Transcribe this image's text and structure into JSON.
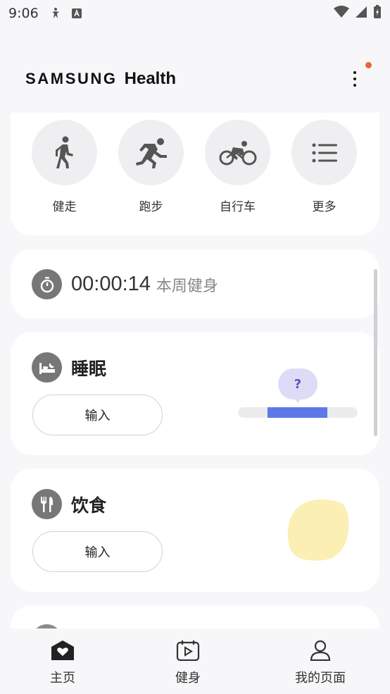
{
  "status_bar": {
    "time": "9:06",
    "icons": [
      "accessibility-icon",
      "keyboard-a-icon",
      "wifi-icon",
      "cellular-icon",
      "battery-icon"
    ]
  },
  "header": {
    "brand_samsung": "SAMSUNG",
    "brand_health": "Health",
    "more_menu_icon": "more-vertical-icon",
    "notification_color": "#e8672e"
  },
  "workouts": {
    "items": [
      {
        "label": "健走",
        "icon": "walking-icon"
      },
      {
        "label": "跑步",
        "icon": "running-icon"
      },
      {
        "label": "自行车",
        "icon": "cycling-icon"
      },
      {
        "label": "更多",
        "icon": "list-icon"
      }
    ]
  },
  "exercise_time": {
    "value": "00:00:14",
    "label": "本周健身",
    "icon": "stopwatch-icon"
  },
  "sleep": {
    "title": "睡眠",
    "icon": "bed-icon",
    "input_label": "输入",
    "bubble_text": "?",
    "bar_color": "#5f78e8"
  },
  "food": {
    "title": "饮食",
    "icon": "fork-knife-icon",
    "input_label": "输入",
    "blob_color": "#fcefb4"
  },
  "bottom_nav": {
    "items": [
      {
        "label": "主页",
        "icon": "home-heart-icon",
        "active": true
      },
      {
        "label": "健身",
        "icon": "calendar-play-icon",
        "active": false
      },
      {
        "label": "我的页面",
        "icon": "person-icon",
        "active": false
      }
    ]
  }
}
